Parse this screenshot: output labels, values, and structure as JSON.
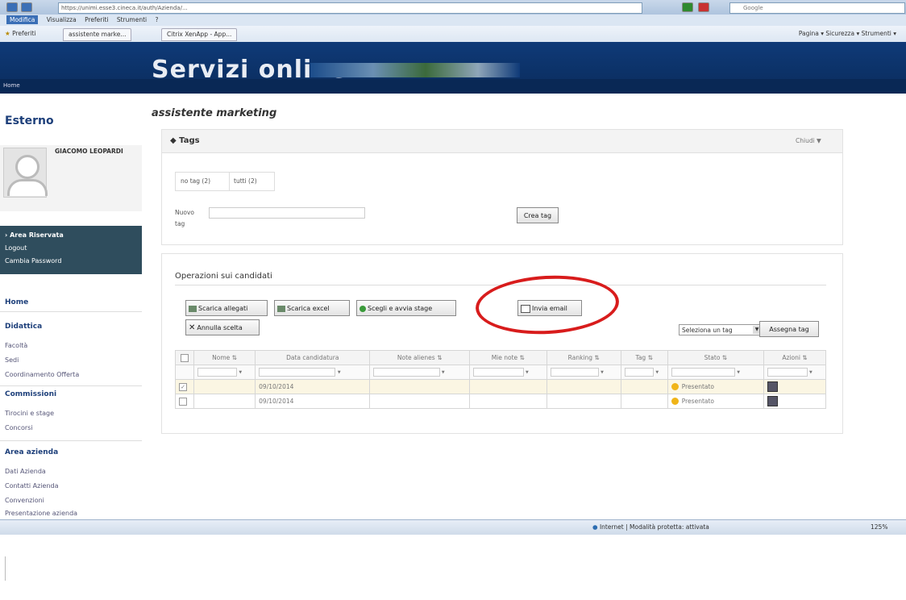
{
  "browser": {
    "url": "https://unimi.esse3.cineca.it/auth/Azienda/...",
    "menu": [
      "Modifica",
      "Visualizza",
      "Preferiti",
      "Strumenti",
      "?"
    ],
    "favorites_label": "Preferiti",
    "tabs": [
      "assistente marke...",
      "Citrix XenApp - App..."
    ],
    "tools": "Pagina ▾  Sicurezza ▾  Strumenti ▾",
    "search_placeholder": "Google"
  },
  "header": {
    "title": "Servizi online",
    "home_link": "Home"
  },
  "sidebar": {
    "section_title": "Esterno",
    "user_name": "GIACOMO LEOPARDI",
    "nav": [
      "Area Riservata",
      "Logout",
      "Cambia Password"
    ],
    "home": "Home",
    "didattica": {
      "title": "Didattica",
      "links": [
        "Facoltà",
        "Sedi",
        "Coordinamento Offerta"
      ]
    },
    "commissioni": {
      "title": "Commissioni",
      "links": [
        "Tirocini e stage",
        "Concorsi"
      ]
    },
    "area_azienda": {
      "title": "Area azienda",
      "links": [
        "Dati Azienda",
        "Contatti Azienda",
        "Convenzioni",
        "Presentazione azienda"
      ]
    }
  },
  "main": {
    "page_title": "assistente marketing",
    "tags_panel": {
      "title": "Tags",
      "close": "Chiudi ▼",
      "tag_tabs": [
        "no tag (2)",
        "tutti (2)"
      ],
      "new_tag_label": "Nuovo tag",
      "create_button": "Crea tag"
    },
    "ops_panel": {
      "title": "Operazioni sui candidati",
      "buttons": [
        "Scarica allegati",
        "Scarica excel",
        "Scegli e avvia stage",
        "Invia email",
        "Annulla scelta"
      ],
      "select_tag": "Seleziona un tag",
      "assign_button": "Assegna tag"
    },
    "table": {
      "columns": [
        "Nome",
        "Data candidatura",
        "Note alienes",
        "Mie note",
        "Ranking",
        "Tag",
        "Stato",
        "Azioni"
      ],
      "rows": [
        {
          "date": "09/10/2014",
          "status": "Presentato",
          "checked": true
        },
        {
          "date": "09/10/2014",
          "status": "Presentato",
          "checked": false
        }
      ]
    }
  },
  "statusbar": {
    "zone": "Internet | Modalità protetta: attivata",
    "zoom": "125%"
  }
}
